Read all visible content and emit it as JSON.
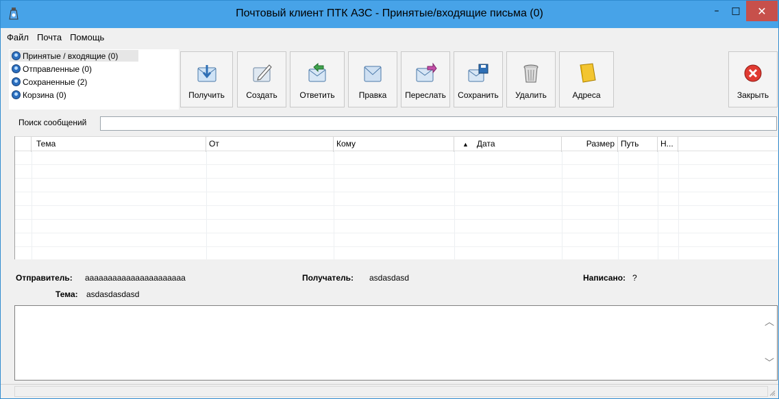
{
  "window": {
    "title": "Почтовый клиент ПТК АЗС -  Принятые/входящие письма (0)",
    "minimize_label": "–",
    "maximize_label": "□",
    "close_label": "✕"
  },
  "menu": [
    {
      "label": "Файл"
    },
    {
      "label": "Почта"
    },
    {
      "label": "Помощь"
    }
  ],
  "folders": [
    {
      "label": "Принятые / входящие (0)",
      "selected": true
    },
    {
      "label": "Отправленные (0)"
    },
    {
      "label": "Сохраненные (2)"
    },
    {
      "label": "Корзина (0)"
    }
  ],
  "toolbar": [
    {
      "label": "Получить",
      "icon": "receive-mail-icon"
    },
    {
      "label": "Создать",
      "icon": "create-mail-icon"
    },
    {
      "label": "Ответить",
      "icon": "reply-mail-icon"
    },
    {
      "label": "Правка",
      "icon": "edit-mail-icon"
    },
    {
      "label": "Переслать",
      "icon": "forward-mail-icon"
    },
    {
      "label": "Сохранить",
      "icon": "save-mail-icon"
    },
    {
      "label": "Удалить",
      "icon": "trash-icon"
    },
    {
      "label": "Адреса",
      "icon": "address-book-icon"
    }
  ],
  "close_button": {
    "label": "Закрыть",
    "icon": "close-circle-icon"
  },
  "search": {
    "label": "Поиск сообщений",
    "value": ""
  },
  "table": {
    "columns": [
      {
        "label": ""
      },
      {
        "label": "Тема"
      },
      {
        "label": "От"
      },
      {
        "label": "Кому"
      },
      {
        "label": "Дата",
        "sort": "ascending"
      },
      {
        "label": "Размер"
      },
      {
        "label": "Путь"
      },
      {
        "label": "Н..."
      }
    ],
    "sort_indicator": "▲",
    "rows": []
  },
  "details": {
    "sender_label": "Отправитель:",
    "sender_value": "aaaaaaaaaaaaaaaaaaaaaa",
    "recipient_label": "Получатель:",
    "recipient_value": "asdasdasd",
    "written_label": "Написано:",
    "written_value": "?",
    "subject_label": "Тема:",
    "subject_value": "asdasdasdasd"
  },
  "colors": {
    "titlebar": "#47a3e8",
    "close": "#c7504b",
    "window_bg": "#f0f0f0"
  }
}
